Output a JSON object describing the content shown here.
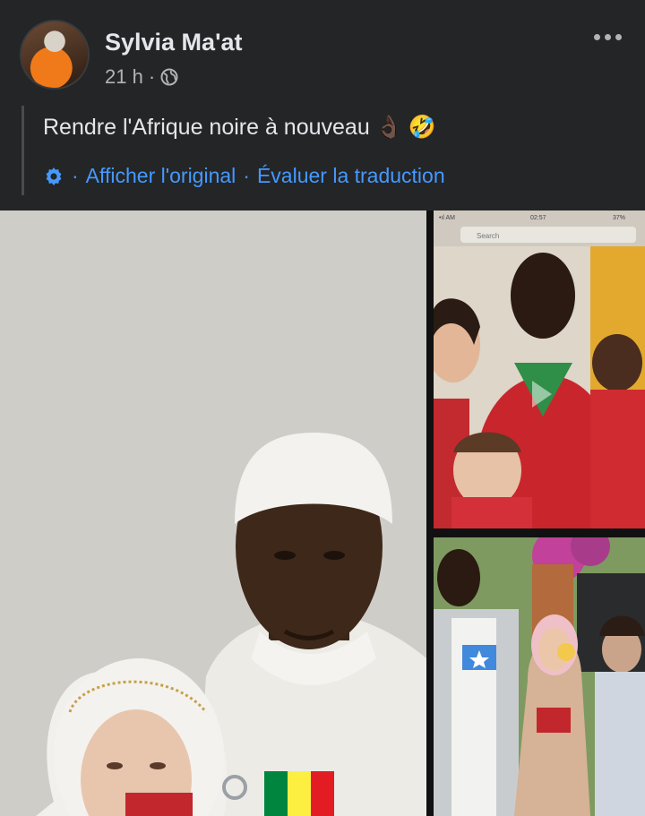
{
  "post": {
    "author": "Sylvia Ma'at",
    "time": "21 h",
    "dot": "·",
    "text": "Rendre l'Afrique noire à nouveau",
    "emoji1": "👌🏿",
    "emoji2": "🤣"
  },
  "translation": {
    "dot1": "·",
    "show_original": "Afficher l'original",
    "dot2": "·",
    "rate": "Évaluer la traduction"
  },
  "photos": {
    "phone_search": "Search",
    "phone_time": "02:57",
    "phone_battery": "37%"
  },
  "colors": {
    "background": "#242526",
    "link": "#4599ff",
    "secondary_text": "#b0b3b8"
  },
  "icons": [
    "avatar",
    "globe-icon",
    "more-icon",
    "gear-icon"
  ]
}
